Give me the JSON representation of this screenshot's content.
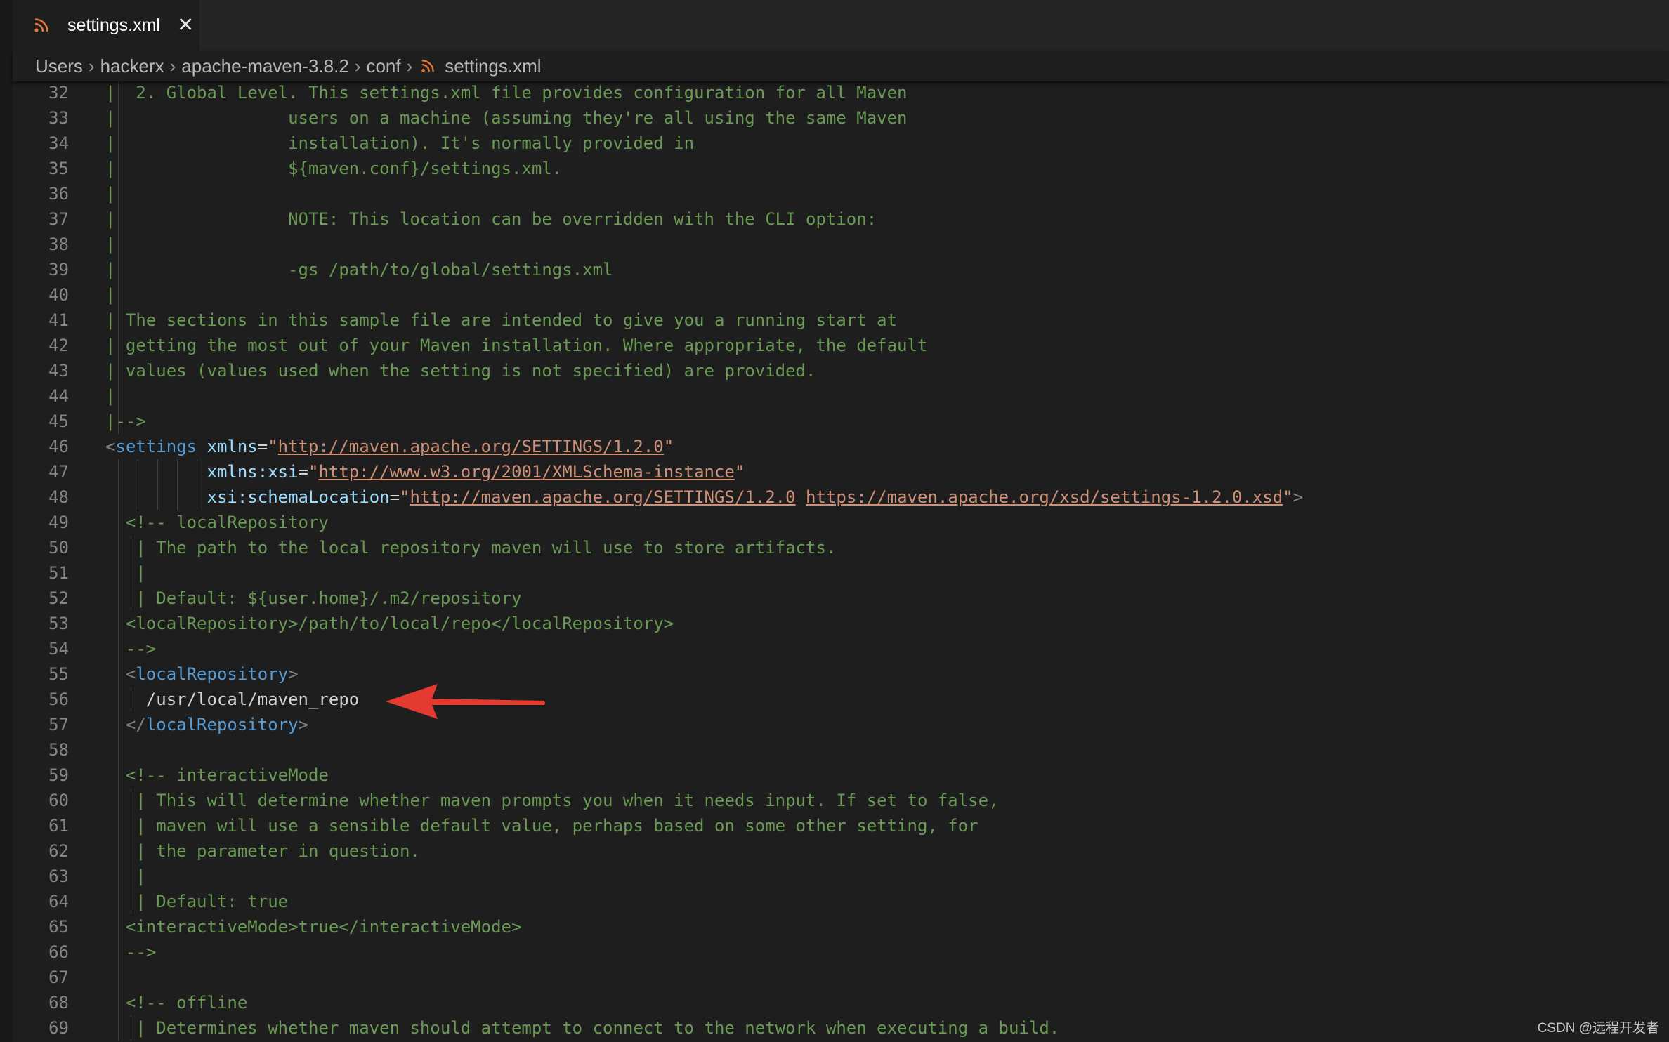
{
  "tab": {
    "label": "settings.xml",
    "icon": "rss-file-icon",
    "close_icon": "close-icon"
  },
  "breadcrumb": [
    "Users",
    "hackerx",
    "apache-maven-3.8.2",
    "conf",
    "settings.xml"
  ],
  "colors": {
    "comment": "#6a9955",
    "tag": "#569cd6",
    "attribute": "#9cdcfe",
    "string": "#ce9178",
    "line_number": "#858585",
    "arrow": "#e53a30",
    "file_icon": "#e37933"
  },
  "code_lines": [
    {
      "n": "32",
      "g": 1,
      "segs": [
        [
          "c",
          "|  2. Global Level. This settings.xml file provides configuration for all Maven"
        ]
      ]
    },
    {
      "n": "33",
      "g": 1,
      "segs": [
        [
          "c",
          "|                 users on a machine (assuming they're all using the same Maven"
        ]
      ]
    },
    {
      "n": "34",
      "g": 1,
      "segs": [
        [
          "c",
          "|                 installation). It's normally provided in"
        ]
      ]
    },
    {
      "n": "35",
      "g": 1,
      "segs": [
        [
          "c",
          "|                 ${maven.conf}/settings.xml."
        ]
      ]
    },
    {
      "n": "36",
      "g": 1,
      "segs": [
        [
          "c",
          "|"
        ]
      ]
    },
    {
      "n": "37",
      "g": 1,
      "segs": [
        [
          "c",
          "|                 NOTE: This location can be overridden with the CLI option:"
        ]
      ]
    },
    {
      "n": "38",
      "g": 1,
      "segs": [
        [
          "c",
          "|"
        ]
      ]
    },
    {
      "n": "39",
      "g": 1,
      "segs": [
        [
          "c",
          "|                 -gs /path/to/global/settings.xml"
        ]
      ]
    },
    {
      "n": "40",
      "g": 1,
      "segs": [
        [
          "c",
          "|"
        ]
      ]
    },
    {
      "n": "41",
      "g": 1,
      "segs": [
        [
          "c",
          "| The sections in this sample file are intended to give you a running start at"
        ]
      ]
    },
    {
      "n": "42",
      "g": 1,
      "segs": [
        [
          "c",
          "| getting the most out of your Maven installation. Where appropriate, the default"
        ]
      ]
    },
    {
      "n": "43",
      "g": 1,
      "segs": [
        [
          "c",
          "| values (values used when the setting is not specified) are provided."
        ]
      ]
    },
    {
      "n": "44",
      "g": 1,
      "segs": [
        [
          "c",
          "|"
        ]
      ]
    },
    {
      "n": "45",
      "g": 1,
      "segs": [
        [
          "c",
          "|-->"
        ]
      ]
    },
    {
      "n": "46",
      "g": 0,
      "segs": [
        [
          "p",
          "<"
        ],
        [
          "t",
          "settings"
        ],
        [
          "x",
          " "
        ],
        [
          "a",
          "xmlns"
        ],
        [
          "x",
          "="
        ],
        [
          "s",
          "\""
        ],
        [
          "u",
          "http://maven.apache.org/SETTINGS/1.2.0"
        ],
        [
          "s",
          "\""
        ]
      ]
    },
    {
      "n": "47",
      "g": 5,
      "segs": [
        [
          "x",
          "          "
        ],
        [
          "a",
          "xmlns:xsi"
        ],
        [
          "x",
          "="
        ],
        [
          "s",
          "\""
        ],
        [
          "u",
          "http://www.w3.org/2001/XMLSchema-instance"
        ],
        [
          "s",
          "\""
        ]
      ]
    },
    {
      "n": "48",
      "g": 5,
      "segs": [
        [
          "x",
          "          "
        ],
        [
          "a",
          "xsi:schemaLocation"
        ],
        [
          "x",
          "="
        ],
        [
          "s",
          "\""
        ],
        [
          "u",
          "http://maven.apache.org/SETTINGS/1.2.0"
        ],
        [
          "s",
          " "
        ],
        [
          "u",
          "https://maven.apache.org/xsd/settings-1.2.0.xsd"
        ],
        [
          "s",
          "\""
        ],
        [
          "p",
          ">"
        ]
      ]
    },
    {
      "n": "49",
      "g": 1,
      "segs": [
        [
          "c",
          "  <!-- localRepository"
        ]
      ]
    },
    {
      "n": "50",
      "g": 2,
      "segs": [
        [
          "c",
          "   | The path to the local repository maven will use to store artifacts."
        ]
      ]
    },
    {
      "n": "51",
      "g": 2,
      "segs": [
        [
          "c",
          "   |"
        ]
      ]
    },
    {
      "n": "52",
      "g": 2,
      "segs": [
        [
          "c",
          "   | Default: ${user.home}/.m2/repository"
        ]
      ]
    },
    {
      "n": "53",
      "g": 1,
      "segs": [
        [
          "c",
          "  <localRepository>/path/to/local/repo</localRepository>"
        ]
      ]
    },
    {
      "n": "54",
      "g": 1,
      "segs": [
        [
          "c",
          "  -->"
        ]
      ]
    },
    {
      "n": "55",
      "g": 1,
      "segs": [
        [
          "x",
          "  "
        ],
        [
          "p",
          "<"
        ],
        [
          "t",
          "localRepository"
        ],
        [
          "p",
          ">"
        ]
      ]
    },
    {
      "n": "56",
      "g": 2,
      "segs": [
        [
          "x",
          "    /usr/local/maven_repo"
        ]
      ]
    },
    {
      "n": "57",
      "g": 1,
      "segs": [
        [
          "x",
          "  "
        ],
        [
          "p",
          "</"
        ],
        [
          "t",
          "localRepository"
        ],
        [
          "p",
          ">"
        ]
      ]
    },
    {
      "n": "58",
      "g": 1,
      "segs": []
    },
    {
      "n": "59",
      "g": 1,
      "segs": [
        [
          "c",
          "  <!-- interactiveMode"
        ]
      ]
    },
    {
      "n": "60",
      "g": 2,
      "segs": [
        [
          "c",
          "   | This will determine whether maven prompts you when it needs input. If set to false,"
        ]
      ]
    },
    {
      "n": "61",
      "g": 2,
      "segs": [
        [
          "c",
          "   | maven will use a sensible default value, perhaps based on some other setting, for"
        ]
      ]
    },
    {
      "n": "62",
      "g": 2,
      "segs": [
        [
          "c",
          "   | the parameter in question."
        ]
      ]
    },
    {
      "n": "63",
      "g": 2,
      "segs": [
        [
          "c",
          "   |"
        ]
      ]
    },
    {
      "n": "64",
      "g": 2,
      "segs": [
        [
          "c",
          "   | Default: true"
        ]
      ]
    },
    {
      "n": "65",
      "g": 1,
      "segs": [
        [
          "c",
          "  <interactiveMode>true</interactiveMode>"
        ]
      ]
    },
    {
      "n": "66",
      "g": 1,
      "segs": [
        [
          "c",
          "  -->"
        ]
      ]
    },
    {
      "n": "67",
      "g": 1,
      "segs": []
    },
    {
      "n": "68",
      "g": 1,
      "segs": [
        [
          "c",
          "  <!-- offline"
        ]
      ]
    },
    {
      "n": "69",
      "g": 2,
      "segs": [
        [
          "c",
          "   | Determines whether maven should attempt to connect to the network when executing a build."
        ]
      ]
    }
  ],
  "annotation": {
    "icon": "red-arrow-icon"
  },
  "watermark": "CSDN @远程开发者"
}
